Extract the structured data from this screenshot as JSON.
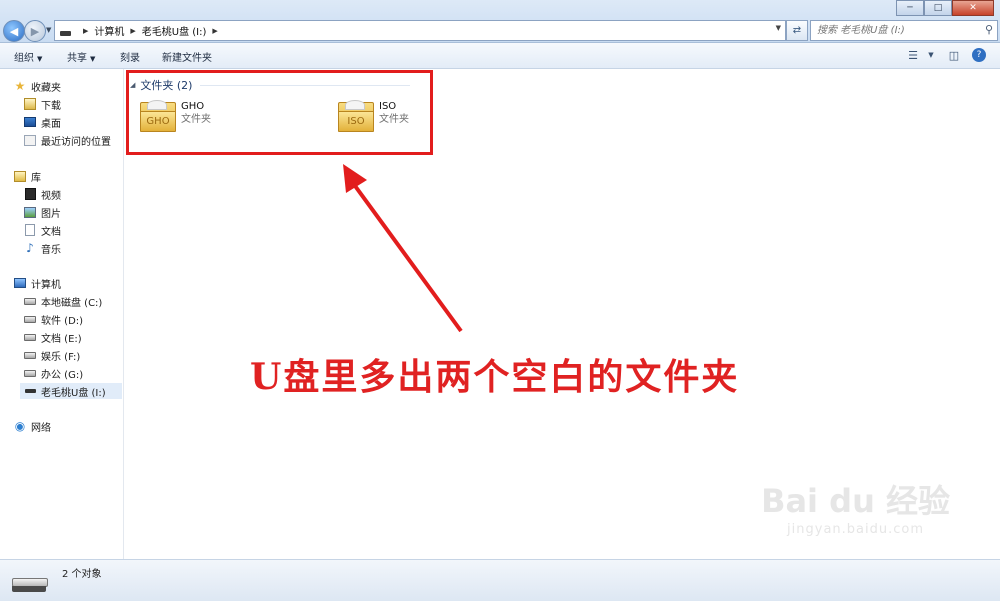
{
  "address_bar": {
    "crumbs": [
      "计算机",
      "老毛桃U盘 (I:)"
    ],
    "search_placeholder": "搜索 老毛桃U盘 (I:)"
  },
  "toolbar": {
    "organize": "组织",
    "share": "共享",
    "burn": "刻录",
    "new_folder": "新建文件夹"
  },
  "sidebar": {
    "favorites": {
      "label": "收藏夹",
      "items": [
        "下载",
        "桌面",
        "最近访问的位置"
      ]
    },
    "libraries": {
      "label": "库",
      "items": [
        "视频",
        "图片",
        "文档",
        "音乐"
      ]
    },
    "computer": {
      "label": "计算机",
      "items": [
        "本地磁盘 (C:)",
        "软件 (D:)",
        "文档 (E:)",
        "娱乐 (F:)",
        "办公 (G:)",
        "老毛桃U盘 (I:)"
      ]
    },
    "network": {
      "label": "网络"
    }
  },
  "content": {
    "group_title": "文件夹 (2)",
    "folders": [
      {
        "name": "GHO",
        "type": "文件夹",
        "badge": "GHO"
      },
      {
        "name": "ISO",
        "type": "文件夹",
        "badge": "ISO"
      }
    ]
  },
  "annotation": {
    "caption": "U盘里多出两个空白的文件夹",
    "color": "#e02222"
  },
  "watermark": {
    "logo": "Bai du 经验",
    "url": "jingyan.baidu.com"
  },
  "status_bar": {
    "text": "2 个对象"
  }
}
